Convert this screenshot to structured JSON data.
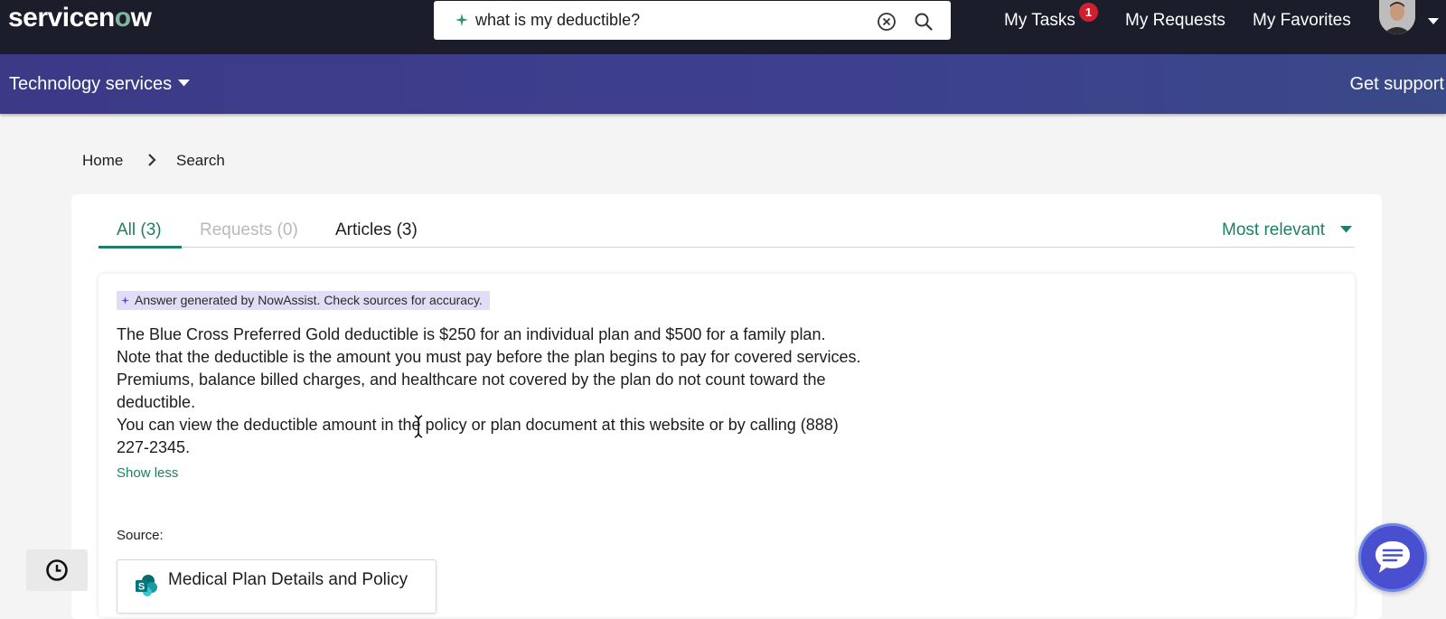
{
  "header": {
    "logo_text_before": "servicen",
    "logo_text_o": "o",
    "logo_text_after": "w",
    "search_value": "what is my deductible?",
    "nav": {
      "my_tasks": "My Tasks",
      "my_tasks_badge": "1",
      "my_requests": "My Requests",
      "my_favorites": "My Favorites"
    }
  },
  "subnav": {
    "left_label": "Technology services",
    "right_label": "Get support"
  },
  "breadcrumb": {
    "home": "Home",
    "current": "Search"
  },
  "tabs": [
    {
      "label": "All (3)",
      "state": "active"
    },
    {
      "label": "Requests (0)",
      "state": "disabled"
    },
    {
      "label": "Articles (3)",
      "state": "normal"
    }
  ],
  "sort_label": "Most relevant",
  "answer": {
    "disclaimer": "Answer generated by NowAssist. Check sources for accuracy.",
    "lines": [
      "The Blue Cross Preferred Gold deductible is $250 for an individual plan and $500 for a family plan.",
      "Note that the deductible is the amount you must pay before the plan begins to pay for covered services.",
      "Premiums, balance billed charges, and healthcare not covered by the plan do not count toward the",
      "deductible.",
      "You can view the deductible amount in the policy or plan document at this website or by calling (888)",
      "227-2345."
    ],
    "show_less": "Show less",
    "source_label": "Source:",
    "source_title": "Medical Plan Details and Policy",
    "source_icon_letter": "S"
  },
  "colors": {
    "header_bg": "#1c1d2b",
    "subnav_bg": "#3c3a87",
    "accent_green": "#1e7f64",
    "badge_red": "#d0202f",
    "chip_bg": "#e2ddf6",
    "chat_button": "#4a4fcf"
  },
  "icons": {
    "search_sparkle": "sparkle-icon",
    "clear": "clear-circle-icon",
    "search": "search-icon",
    "dropdown": "caret-down-icon",
    "breadcrumb_sep": "chevron-right-icon",
    "history": "clock-icon",
    "chat": "chat-bubble-icon",
    "source": "sharepoint-icon"
  }
}
